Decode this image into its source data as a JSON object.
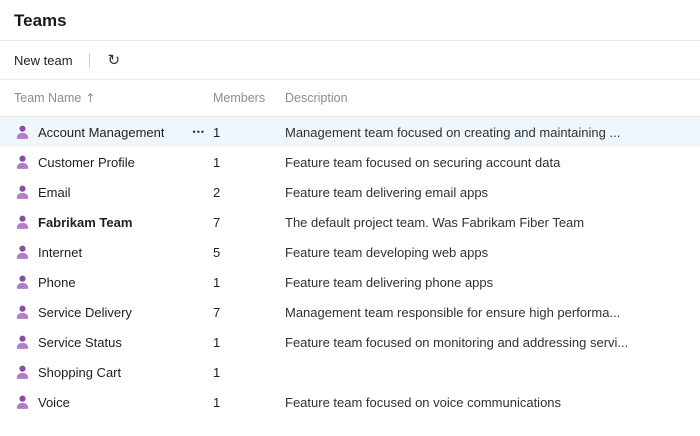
{
  "page": {
    "title": "Teams"
  },
  "toolbar": {
    "new_team_label": "New team",
    "refresh_icon": "↻"
  },
  "table": {
    "columns": [
      {
        "label": "Team Name",
        "sorted": "ascending"
      },
      {
        "label": "Members"
      },
      {
        "label": "Description"
      }
    ],
    "sort_icon": "↑",
    "more_icon": "•••",
    "rows": [
      {
        "name": "Account Management",
        "members": "1",
        "description": "Management team focused on creating and maintaining ...",
        "highlighted": true,
        "show_more": true,
        "bold": false
      },
      {
        "name": "Customer Profile",
        "members": "1",
        "description": "Feature team focused on securing account data",
        "highlighted": false,
        "show_more": false,
        "bold": false
      },
      {
        "name": "Email",
        "members": "2",
        "description": "Feature team delivering email apps",
        "highlighted": false,
        "show_more": false,
        "bold": false
      },
      {
        "name": "Fabrikam Team",
        "members": "7",
        "description": "The default project team. Was Fabrikam Fiber Team",
        "highlighted": false,
        "show_more": false,
        "bold": true
      },
      {
        "name": "Internet",
        "members": "5",
        "description": "Feature team developing web apps",
        "highlighted": false,
        "show_more": false,
        "bold": false
      },
      {
        "name": "Phone",
        "members": "1",
        "description": "Feature team delivering phone apps",
        "highlighted": false,
        "show_more": false,
        "bold": false
      },
      {
        "name": "Service Delivery",
        "members": "7",
        "description": "Management team responsible for ensure high performa...",
        "highlighted": false,
        "show_more": false,
        "bold": false
      },
      {
        "name": "Service Status",
        "members": "1",
        "description": "Feature team focused on monitoring and addressing servi...",
        "highlighted": false,
        "show_more": false,
        "bold": false
      },
      {
        "name": "Shopping Cart",
        "members": "1",
        "description": "",
        "highlighted": false,
        "show_more": false,
        "bold": false
      },
      {
        "name": "Voice",
        "members": "1",
        "description": "Feature team focused on voice communications",
        "highlighted": false,
        "show_more": false,
        "bold": false
      }
    ]
  },
  "colors": {
    "team_icon_head_purple": "#8a4aa5",
    "team_icon_body_purple": "#b07fc7",
    "highlighted_row_blue": "#eff6fc"
  }
}
